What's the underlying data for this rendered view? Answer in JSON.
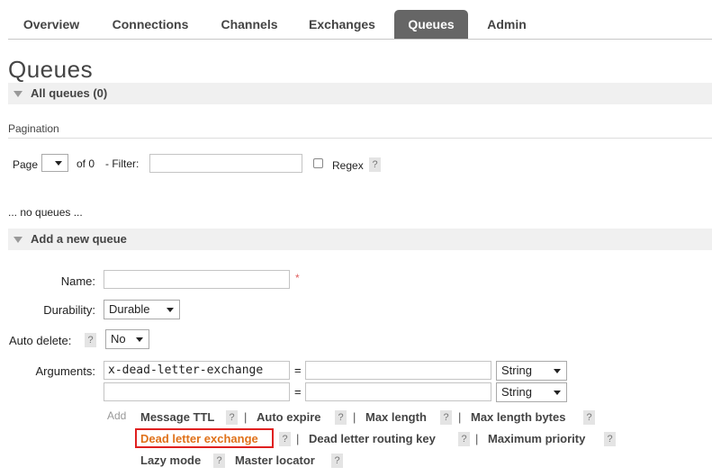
{
  "nav": {
    "tabs": [
      {
        "label": "Overview",
        "active": false
      },
      {
        "label": "Connections",
        "active": false
      },
      {
        "label": "Channels",
        "active": false
      },
      {
        "label": "Exchanges",
        "active": false
      },
      {
        "label": "Queues",
        "active": true
      },
      {
        "label": "Admin",
        "active": false
      }
    ]
  },
  "page": {
    "title": "Queues",
    "all_queues_label": "All queues (0)",
    "no_queues_text": "... no queues ...",
    "add_queue_label": "Add a new queue"
  },
  "pagination": {
    "heading": "Pagination",
    "page_label": "Page",
    "page_value": "",
    "of_text": "of 0",
    "filter_label": "- Filter:",
    "filter_value": "",
    "regex_label": "Regex",
    "regex_checked": false,
    "help": "?"
  },
  "form": {
    "name_label": "Name:",
    "name_value": "",
    "required_mark": "*",
    "durability_label": "Durability:",
    "durability_value": "Durable",
    "auto_delete_label": "Auto delete:",
    "auto_delete_value": "No",
    "arguments_label": "Arguments:",
    "arguments": [
      {
        "key": "x-dead-letter-exchange",
        "equals": "=",
        "value": "",
        "type": "String"
      },
      {
        "key": "",
        "equals": "=",
        "value": "",
        "type": "String"
      }
    ],
    "add_label": "Add",
    "help": "?",
    "pipe": "|",
    "arg_links": {
      "message_ttl": "Message TTL",
      "auto_expire": "Auto expire",
      "max_length": "Max length",
      "max_length_bytes": "Max length bytes",
      "dead_letter_exchange": "Dead letter exchange",
      "dead_letter_routing_key": "Dead letter routing key",
      "maximum_priority": "Maximum priority",
      "lazy_mode": "Lazy mode",
      "master_locator": "Master locator"
    }
  },
  "colors": {
    "active_tab": "#666666",
    "highlight_link": "#e0711a",
    "highlight_border": "#e02020"
  }
}
